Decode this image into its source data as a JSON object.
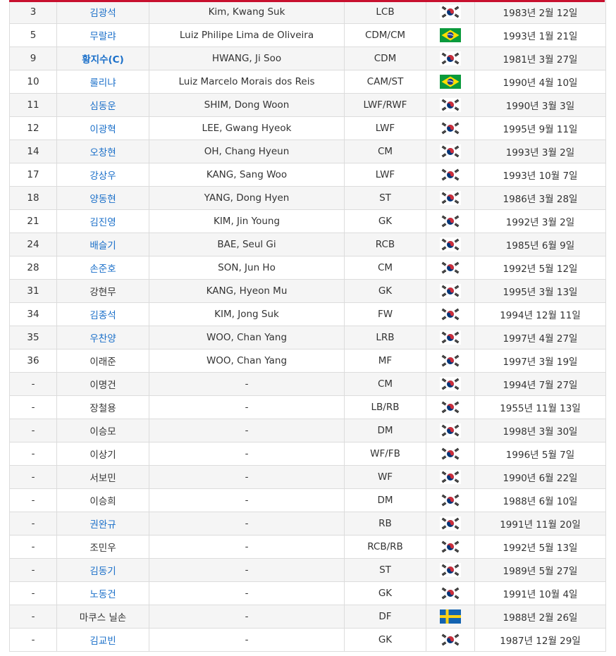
{
  "roster": [
    {
      "number": "3",
      "name": "김광석",
      "linked": true,
      "captain": false,
      "english_name": "Kim, Kwang Suk",
      "position": "LCB",
      "flag": "korea-flag-icon",
      "birth": "1983년 2월 12일"
    },
    {
      "number": "5",
      "name": "무랄랴",
      "linked": true,
      "captain": false,
      "english_name": "Luiz Philipe Lima de Oliveira",
      "position": "CDM/CM",
      "flag": "brazil-flag-icon",
      "birth": "1993년 1월 21일"
    },
    {
      "number": "9",
      "name": "황지수(C)",
      "linked": true,
      "captain": true,
      "english_name": "HWANG, Ji Soo",
      "position": "CDM",
      "flag": "korea-flag-icon",
      "birth": "1981년 3월 27일"
    },
    {
      "number": "10",
      "name": "룰리냐",
      "linked": true,
      "captain": false,
      "english_name": "Luiz Marcelo Morais dos Reis",
      "position": "CAM/ST",
      "flag": "brazil-flag-icon",
      "birth": "1990년 4월 10일"
    },
    {
      "number": "11",
      "name": "심동운",
      "linked": true,
      "captain": false,
      "english_name": "SHIM, Dong Woon",
      "position": "LWF/RWF",
      "flag": "korea-flag-icon",
      "birth": "1990년 3월 3일"
    },
    {
      "number": "12",
      "name": "이광혁",
      "linked": true,
      "captain": false,
      "english_name": "LEE, Gwang Hyeok",
      "position": "LWF",
      "flag": "korea-flag-icon",
      "birth": "1995년 9월 11일"
    },
    {
      "number": "14",
      "name": "오창현",
      "linked": true,
      "captain": false,
      "english_name": "OH, Chang Hyeun",
      "position": "CM",
      "flag": "korea-flag-icon",
      "birth": "1993년 3월 2일"
    },
    {
      "number": "17",
      "name": "강상우",
      "linked": true,
      "captain": false,
      "english_name": "KANG, Sang Woo",
      "position": "LWF",
      "flag": "korea-flag-icon",
      "birth": "1993년 10월 7일"
    },
    {
      "number": "18",
      "name": "양동현",
      "linked": true,
      "captain": false,
      "english_name": "YANG, Dong Hyen",
      "position": "ST",
      "flag": "korea-flag-icon",
      "birth": "1986년 3월 28일"
    },
    {
      "number": "21",
      "name": "김진영",
      "linked": true,
      "captain": false,
      "english_name": "KIM, Jin Young",
      "position": "GK",
      "flag": "korea-flag-icon",
      "birth": "1992년 3월 2일"
    },
    {
      "number": "24",
      "name": "배슬기",
      "linked": true,
      "captain": false,
      "english_name": "BAE, Seul Gi",
      "position": "RCB",
      "flag": "korea-flag-icon",
      "birth": "1985년 6월 9일"
    },
    {
      "number": "28",
      "name": "손준호",
      "linked": true,
      "captain": false,
      "english_name": "SON, Jun Ho",
      "position": "CM",
      "flag": "korea-flag-icon",
      "birth": "1992년 5월 12일"
    },
    {
      "number": "31",
      "name": "강현무",
      "linked": false,
      "captain": false,
      "english_name": "KANG, Hyeon Mu",
      "position": "GK",
      "flag": "korea-flag-icon",
      "birth": "1995년 3월 13일"
    },
    {
      "number": "34",
      "name": "김종석",
      "linked": true,
      "captain": false,
      "english_name": "KIM, Jong Suk",
      "position": "FW",
      "flag": "korea-flag-icon",
      "birth": "1994년 12월 11일"
    },
    {
      "number": "35",
      "name": "우찬양",
      "linked": true,
      "captain": false,
      "english_name": "WOO, Chan Yang",
      "position": "LRB",
      "flag": "korea-flag-icon",
      "birth": "1997년 4월 27일"
    },
    {
      "number": "36",
      "name": "이래준",
      "linked": false,
      "captain": false,
      "english_name": "WOO, Chan Yang",
      "position": "MF",
      "flag": "korea-flag-icon",
      "birth": "1997년 3월 19일"
    },
    {
      "number": "-",
      "name": "이명건",
      "linked": false,
      "captain": false,
      "english_name": "-",
      "position": "CM",
      "flag": "korea-flag-icon",
      "birth": "1994년 7월 27일"
    },
    {
      "number": "-",
      "name": "장철용",
      "linked": false,
      "captain": false,
      "english_name": "-",
      "position": "LB/RB",
      "flag": "korea-flag-icon",
      "birth": "1955년 11월 13일"
    },
    {
      "number": "-",
      "name": "이승모",
      "linked": false,
      "captain": false,
      "english_name": "-",
      "position": "DM",
      "flag": "korea-flag-icon",
      "birth": "1998년 3월 30일"
    },
    {
      "number": "-",
      "name": "이상기",
      "linked": false,
      "captain": false,
      "english_name": "-",
      "position": "WF/FB",
      "flag": "korea-flag-icon",
      "birth": "1996년 5월 7일"
    },
    {
      "number": "-",
      "name": "서보민",
      "linked": false,
      "captain": false,
      "english_name": "-",
      "position": "WF",
      "flag": "korea-flag-icon",
      "birth": "1990년 6월 22일"
    },
    {
      "number": "-",
      "name": "이승희",
      "linked": false,
      "captain": false,
      "english_name": "-",
      "position": "DM",
      "flag": "korea-flag-icon",
      "birth": "1988년 6월 10일"
    },
    {
      "number": "-",
      "name": "권완규",
      "linked": true,
      "captain": false,
      "english_name": "-",
      "position": "RB",
      "flag": "korea-flag-icon",
      "birth": "1991년 11월 20일"
    },
    {
      "number": "-",
      "name": "조민우",
      "linked": false,
      "captain": false,
      "english_name": "-",
      "position": "RCB/RB",
      "flag": "korea-flag-icon",
      "birth": "1992년 5월 13일"
    },
    {
      "number": "-",
      "name": "김동기",
      "linked": true,
      "captain": false,
      "english_name": "-",
      "position": "ST",
      "flag": "korea-flag-icon",
      "birth": "1989년 5월 27일"
    },
    {
      "number": "-",
      "name": "노동건",
      "linked": true,
      "captain": false,
      "english_name": "-",
      "position": "GK",
      "flag": "korea-flag-icon",
      "birth": "1991년 10월 4일"
    },
    {
      "number": "-",
      "name": "마쿠스 닐손",
      "linked": false,
      "captain": false,
      "english_name": "-",
      "position": "DF",
      "flag": "sweden-flag-icon",
      "birth": "1988년 2월 26일"
    },
    {
      "number": "-",
      "name": "김교빈",
      "linked": true,
      "captain": false,
      "english_name": "-",
      "position": "GK",
      "flag": "korea-flag-icon",
      "birth": "1987년 12월 29일"
    }
  ]
}
